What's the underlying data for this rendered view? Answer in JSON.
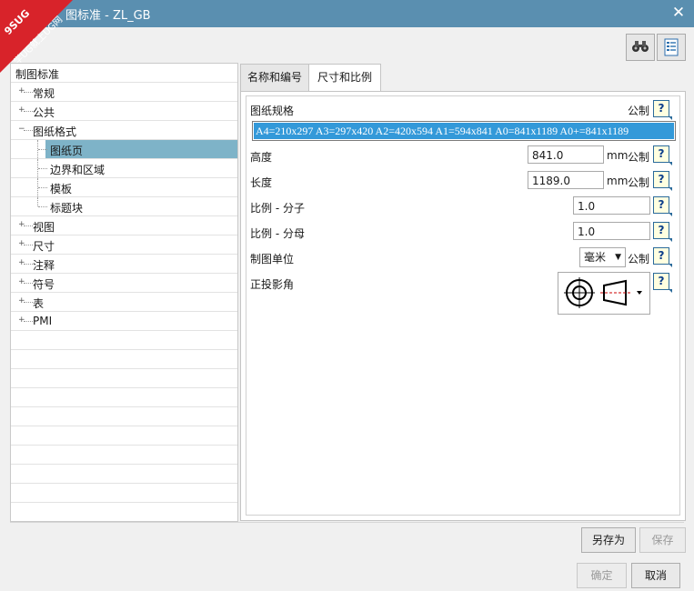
{
  "window": {
    "title": "图标准 - ZL_GB",
    "close_label": "✕"
  },
  "watermark": {
    "line1": "9SUG",
    "line2": "学UG就上UG网"
  },
  "toolbar": {
    "find_icon": "binoculars-icon",
    "sheet_icon": "sheet-list-icon"
  },
  "tree": {
    "root": "制图标准",
    "items": [
      {
        "label": "常规",
        "expander": "+"
      },
      {
        "label": "公共",
        "expander": "+"
      },
      {
        "label": "图纸格式",
        "expander": "−"
      },
      {
        "label": "图纸页",
        "child": true,
        "selected": true
      },
      {
        "label": "边界和区域",
        "child": true
      },
      {
        "label": "模板",
        "child": true
      },
      {
        "label": "标题块",
        "child": true
      },
      {
        "label": "视图",
        "expander": "+"
      },
      {
        "label": "尺寸",
        "expander": "+"
      },
      {
        "label": "注释",
        "expander": "+"
      },
      {
        "label": "符号",
        "expander": "+"
      },
      {
        "label": "表",
        "expander": "+"
      },
      {
        "label": "PMI",
        "expander": "+"
      }
    ]
  },
  "tabs": [
    {
      "label": "名称和编号",
      "active": false
    },
    {
      "label": "尺寸和比例",
      "active": true
    }
  ],
  "panel": {
    "sheet_spec_label": "图纸规格",
    "metric_label": "公制",
    "sheet_spec_value": "A4=210x297 A3=297x420 A2=420x594 A1=594x841 A0=841x1189 A0+=841x1189",
    "height_label": "高度",
    "height_value": "841.0",
    "height_unit": "mm",
    "length_label": "长度",
    "length_value": "1189.0",
    "length_unit": "mm",
    "scale_num_label": "比例 - 分子",
    "scale_num_value": "1.0",
    "scale_den_label": "比例 - 分母",
    "scale_den_value": "1.0",
    "units_label": "制图单位",
    "units_value": "毫米",
    "projection_label": "正投影角",
    "help_label": "?"
  },
  "buttons": {
    "save_as": "另存为",
    "save": "保存",
    "ok": "确定",
    "cancel": "取消"
  }
}
